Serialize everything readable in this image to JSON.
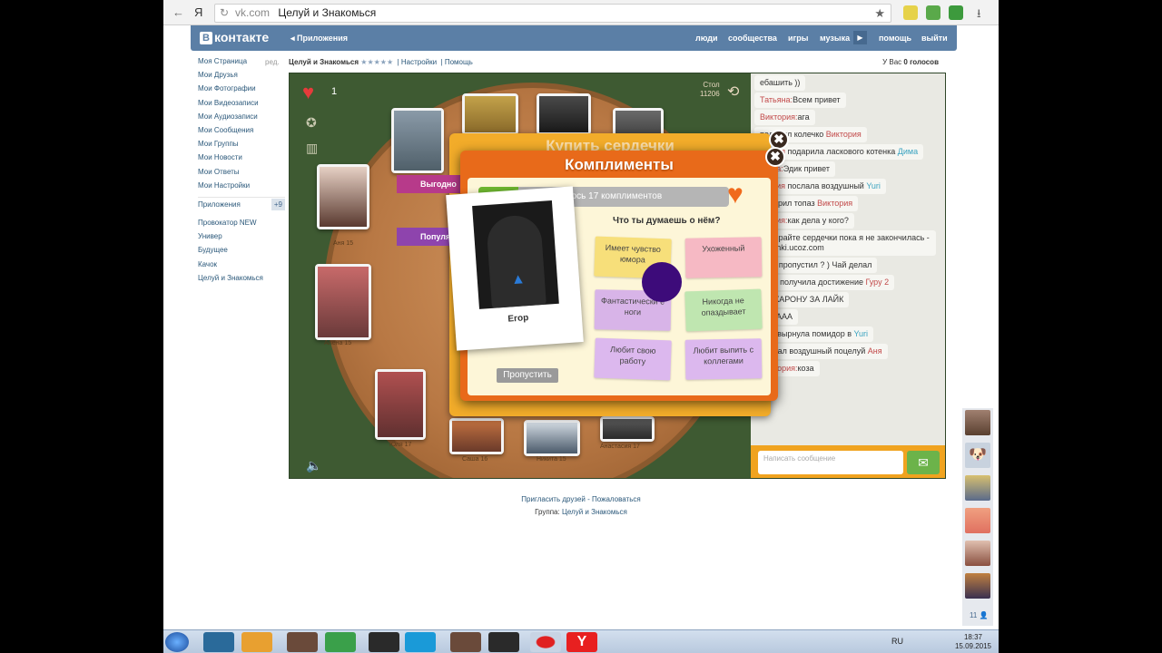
{
  "browser": {
    "domain": "vk.com",
    "page_title": "Целуй и Знакомься",
    "back_label": "←",
    "yandex_label": "Я"
  },
  "vk_header": {
    "logo": "контакте",
    "logo_box": "В",
    "apps_link": "Приложения",
    "nav": [
      "люди",
      "сообщества",
      "игры",
      "музыка",
      "помощь",
      "выйти"
    ]
  },
  "left_menu": {
    "edit": "ред.",
    "items": [
      "Моя Страница",
      "Мои Друзья",
      "Мои Фотографии",
      "Мои Видеозаписи",
      "Мои Аудиозаписи",
      "Мои Сообщения",
      "Мои Группы",
      "Мои Новости",
      "Мои Ответы",
      "Мои Настройки"
    ],
    "apps_label": "Приложения",
    "apps_count": "+9",
    "app_list": [
      "Провокатор NEW",
      "Универ",
      "Будущее",
      "Качок",
      "Целуй и Знакомься"
    ]
  },
  "app_header": {
    "app_name": "Целуй и Знакомься",
    "stars": "★★★★★",
    "settings": "Настройки",
    "help": "Помощь",
    "votes_prefix": "У Вас",
    "votes_value": "0 голосов"
  },
  "game": {
    "heart_count": "1",
    "table_label": "Стол",
    "table_number": "11206",
    "ribbons": [
      "Выгодно",
      "Популя"
    ],
    "player_labels": [
      "Аня 15",
      "Алёна 15",
      "Юля 17",
      "Саша 16",
      "Никита 15",
      "Анастасия 17"
    ]
  },
  "modal_back": {
    "title": "Купить сердечки"
  },
  "modal": {
    "title": "Комплименты",
    "progress_text": "Осталось 17 комплиментов",
    "progress_fraction": 0.16,
    "question": "Что ты думаешь о нём?",
    "person_name": "Егор",
    "skip": "Пропустить",
    "compliments": [
      "Имеет чувство юмора",
      "Ухоженный",
      "Фантастически е ноги",
      "Никогда не опаздывает",
      "Любит свою работу",
      "Любит выпить с коллегами"
    ],
    "close_glyph": "✖"
  },
  "chat": {
    "messages": [
      {
        "name": "",
        "text": "ебашить ))"
      },
      {
        "name": "Татьяна:",
        "text": "Всем привет"
      },
      {
        "name": "Виктория:",
        "text": "ага"
      },
      {
        "name": "",
        "text": "подарил колечко ",
        "target": "Виктория"
      },
      {
        "name": "ктория",
        "text": " подарила ласкового котенка ",
        "target": "Дима"
      },
      {
        "name": "ввета:",
        "text": "Эдик привет"
      },
      {
        "name": "ктория",
        "text": " послала воздушный ",
        "target": "Yuri"
      },
      {
        "name": "",
        "text": "подарил топаз ",
        "target": "Виктория"
      },
      {
        "name": "ктория:",
        "text": "как дела у кого?"
      },
      {
        "name": "",
        "text": "Забирайте сердечки пока я не закончилась ---> chki.ucoz.com"
      },
      {
        "name": "",
        "text": "Кого пропустил ? ) Чай делал"
      },
      {
        "name": "вена",
        "text": " получила достижение ",
        "target": "Гуру 2"
      },
      {
        "name": "",
        "text": "АМ КАРОНУ ЗА ЛАЙК"
      },
      {
        "name": "",
        "text": "АААААА"
      },
      {
        "name": "ся",
        "text": " швырнула помидор в ",
        "target": "Yuri"
      },
      {
        "name": "",
        "text": "послал воздушный поцелуй ",
        "target": "Аня"
      },
      {
        "name": "Виктория:",
        "text": "коза"
      }
    ],
    "input_placeholder": "Написать сообщение",
    "send_glyph": "✉"
  },
  "footer": {
    "invite": "Пригласить друзей",
    "separator": " - ",
    "complain": "Пожаловаться",
    "group_prefix": "Группа:",
    "group_name": "Целуй и Знакомься"
  },
  "friends": {
    "count": "11 👤"
  },
  "taskbar": {
    "lang": "RU",
    "time": "18:37",
    "date": "15.09.2015"
  },
  "colors": {
    "vk_blue": "#5b7fa6",
    "modal_orange": "#e86a1a",
    "progress_green": "#6fb830",
    "cursor_purple": "#3d0b7a"
  }
}
